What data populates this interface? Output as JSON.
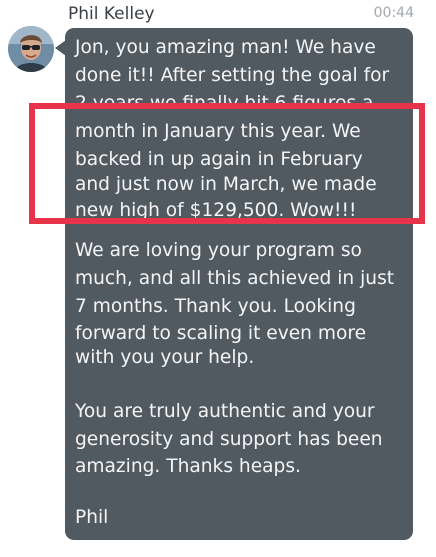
{
  "message": {
    "sender": "Phil Kelley",
    "time": "00:44",
    "avatar": "avatar-photo",
    "lines": [
      "Jon, you amazing man! We have",
      "done it!! After setting the goal for",
      "2 years we finally hit 6 figures a",
      "month in January this year. We",
      "backed in up again in February",
      "and just now in March, we made",
      "new high of $129,500. Wow!!!",
      "",
      "We are loving your program so",
      "much, and all this achieved in just",
      "7 months. Thank you. Looking",
      "forward to scaling it even more",
      "with you your help.",
      "",
      "You are truly authentic and your",
      "generosity and support has been",
      "amazing. Thanks heaps.",
      "",
      "Phil"
    ]
  },
  "colors": {
    "bubble": "#525a61",
    "bubble_text": "#f3f4f5",
    "highlight_box": "#e8344b",
    "sender_name": "#3a3f45",
    "timestamp": "#a3a8ad"
  }
}
